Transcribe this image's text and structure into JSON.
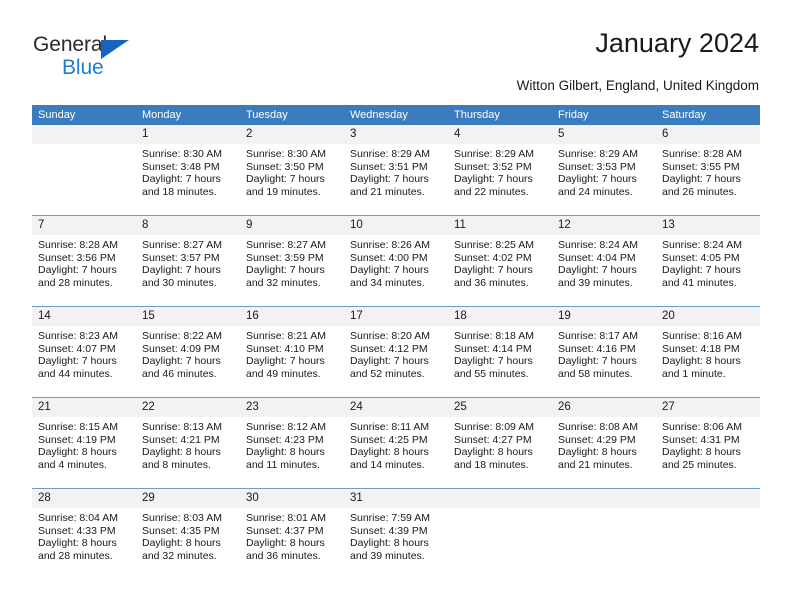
{
  "brand": {
    "name_top": "General",
    "name_bottom": "Blue",
    "accent_color": "#1a7fd4",
    "triangle_color": "#1565c0"
  },
  "header": {
    "title": "January 2024",
    "subtitle": "Witton Gilbert, England, United Kingdom"
  },
  "calendar": {
    "header_color": "#3a7cbe",
    "daynum_band_color": "#f2f2f2",
    "weekdays": [
      "Sunday",
      "Monday",
      "Tuesday",
      "Wednesday",
      "Thursday",
      "Friday",
      "Saturday"
    ],
    "weeks": [
      [
        {
          "day": "",
          "sunrise": "",
          "sunset": "",
          "daylight_1": "",
          "daylight_2": ""
        },
        {
          "day": "1",
          "sunrise": "Sunrise: 8:30 AM",
          "sunset": "Sunset: 3:48 PM",
          "daylight_1": "Daylight: 7 hours",
          "daylight_2": "and 18 minutes."
        },
        {
          "day": "2",
          "sunrise": "Sunrise: 8:30 AM",
          "sunset": "Sunset: 3:50 PM",
          "daylight_1": "Daylight: 7 hours",
          "daylight_2": "and 19 minutes."
        },
        {
          "day": "3",
          "sunrise": "Sunrise: 8:29 AM",
          "sunset": "Sunset: 3:51 PM",
          "daylight_1": "Daylight: 7 hours",
          "daylight_2": "and 21 minutes."
        },
        {
          "day": "4",
          "sunrise": "Sunrise: 8:29 AM",
          "sunset": "Sunset: 3:52 PM",
          "daylight_1": "Daylight: 7 hours",
          "daylight_2": "and 22 minutes."
        },
        {
          "day": "5",
          "sunrise": "Sunrise: 8:29 AM",
          "sunset": "Sunset: 3:53 PM",
          "daylight_1": "Daylight: 7 hours",
          "daylight_2": "and 24 minutes."
        },
        {
          "day": "6",
          "sunrise": "Sunrise: 8:28 AM",
          "sunset": "Sunset: 3:55 PM",
          "daylight_1": "Daylight: 7 hours",
          "daylight_2": "and 26 minutes."
        }
      ],
      [
        {
          "day": "7",
          "sunrise": "Sunrise: 8:28 AM",
          "sunset": "Sunset: 3:56 PM",
          "daylight_1": "Daylight: 7 hours",
          "daylight_2": "and 28 minutes."
        },
        {
          "day": "8",
          "sunrise": "Sunrise: 8:27 AM",
          "sunset": "Sunset: 3:57 PM",
          "daylight_1": "Daylight: 7 hours",
          "daylight_2": "and 30 minutes."
        },
        {
          "day": "9",
          "sunrise": "Sunrise: 8:27 AM",
          "sunset": "Sunset: 3:59 PM",
          "daylight_1": "Daylight: 7 hours",
          "daylight_2": "and 32 minutes."
        },
        {
          "day": "10",
          "sunrise": "Sunrise: 8:26 AM",
          "sunset": "Sunset: 4:00 PM",
          "daylight_1": "Daylight: 7 hours",
          "daylight_2": "and 34 minutes."
        },
        {
          "day": "11",
          "sunrise": "Sunrise: 8:25 AM",
          "sunset": "Sunset: 4:02 PM",
          "daylight_1": "Daylight: 7 hours",
          "daylight_2": "and 36 minutes."
        },
        {
          "day": "12",
          "sunrise": "Sunrise: 8:24 AM",
          "sunset": "Sunset: 4:04 PM",
          "daylight_1": "Daylight: 7 hours",
          "daylight_2": "and 39 minutes."
        },
        {
          "day": "13",
          "sunrise": "Sunrise: 8:24 AM",
          "sunset": "Sunset: 4:05 PM",
          "daylight_1": "Daylight: 7 hours",
          "daylight_2": "and 41 minutes."
        }
      ],
      [
        {
          "day": "14",
          "sunrise": "Sunrise: 8:23 AM",
          "sunset": "Sunset: 4:07 PM",
          "daylight_1": "Daylight: 7 hours",
          "daylight_2": "and 44 minutes."
        },
        {
          "day": "15",
          "sunrise": "Sunrise: 8:22 AM",
          "sunset": "Sunset: 4:09 PM",
          "daylight_1": "Daylight: 7 hours",
          "daylight_2": "and 46 minutes."
        },
        {
          "day": "16",
          "sunrise": "Sunrise: 8:21 AM",
          "sunset": "Sunset: 4:10 PM",
          "daylight_1": "Daylight: 7 hours",
          "daylight_2": "and 49 minutes."
        },
        {
          "day": "17",
          "sunrise": "Sunrise: 8:20 AM",
          "sunset": "Sunset: 4:12 PM",
          "daylight_1": "Daylight: 7 hours",
          "daylight_2": "and 52 minutes."
        },
        {
          "day": "18",
          "sunrise": "Sunrise: 8:18 AM",
          "sunset": "Sunset: 4:14 PM",
          "daylight_1": "Daylight: 7 hours",
          "daylight_2": "and 55 minutes."
        },
        {
          "day": "19",
          "sunrise": "Sunrise: 8:17 AM",
          "sunset": "Sunset: 4:16 PM",
          "daylight_1": "Daylight: 7 hours",
          "daylight_2": "and 58 minutes."
        },
        {
          "day": "20",
          "sunrise": "Sunrise: 8:16 AM",
          "sunset": "Sunset: 4:18 PM",
          "daylight_1": "Daylight: 8 hours",
          "daylight_2": "and 1 minute."
        }
      ],
      [
        {
          "day": "21",
          "sunrise": "Sunrise: 8:15 AM",
          "sunset": "Sunset: 4:19 PM",
          "daylight_1": "Daylight: 8 hours",
          "daylight_2": "and 4 minutes."
        },
        {
          "day": "22",
          "sunrise": "Sunrise: 8:13 AM",
          "sunset": "Sunset: 4:21 PM",
          "daylight_1": "Daylight: 8 hours",
          "daylight_2": "and 8 minutes."
        },
        {
          "day": "23",
          "sunrise": "Sunrise: 8:12 AM",
          "sunset": "Sunset: 4:23 PM",
          "daylight_1": "Daylight: 8 hours",
          "daylight_2": "and 11 minutes."
        },
        {
          "day": "24",
          "sunrise": "Sunrise: 8:11 AM",
          "sunset": "Sunset: 4:25 PM",
          "daylight_1": "Daylight: 8 hours",
          "daylight_2": "and 14 minutes."
        },
        {
          "day": "25",
          "sunrise": "Sunrise: 8:09 AM",
          "sunset": "Sunset: 4:27 PM",
          "daylight_1": "Daylight: 8 hours",
          "daylight_2": "and 18 minutes."
        },
        {
          "day": "26",
          "sunrise": "Sunrise: 8:08 AM",
          "sunset": "Sunset: 4:29 PM",
          "daylight_1": "Daylight: 8 hours",
          "daylight_2": "and 21 minutes."
        },
        {
          "day": "27",
          "sunrise": "Sunrise: 8:06 AM",
          "sunset": "Sunset: 4:31 PM",
          "daylight_1": "Daylight: 8 hours",
          "daylight_2": "and 25 minutes."
        }
      ],
      [
        {
          "day": "28",
          "sunrise": "Sunrise: 8:04 AM",
          "sunset": "Sunset: 4:33 PM",
          "daylight_1": "Daylight: 8 hours",
          "daylight_2": "and 28 minutes."
        },
        {
          "day": "29",
          "sunrise": "Sunrise: 8:03 AM",
          "sunset": "Sunset: 4:35 PM",
          "daylight_1": "Daylight: 8 hours",
          "daylight_2": "and 32 minutes."
        },
        {
          "day": "30",
          "sunrise": "Sunrise: 8:01 AM",
          "sunset": "Sunset: 4:37 PM",
          "daylight_1": "Daylight: 8 hours",
          "daylight_2": "and 36 minutes."
        },
        {
          "day": "31",
          "sunrise": "Sunrise: 7:59 AM",
          "sunset": "Sunset: 4:39 PM",
          "daylight_1": "Daylight: 8 hours",
          "daylight_2": "and 39 minutes."
        },
        {
          "day": "",
          "sunrise": "",
          "sunset": "",
          "daylight_1": "",
          "daylight_2": ""
        },
        {
          "day": "",
          "sunrise": "",
          "sunset": "",
          "daylight_1": "",
          "daylight_2": ""
        },
        {
          "day": "",
          "sunrise": "",
          "sunset": "",
          "daylight_1": "",
          "daylight_2": ""
        }
      ]
    ]
  }
}
